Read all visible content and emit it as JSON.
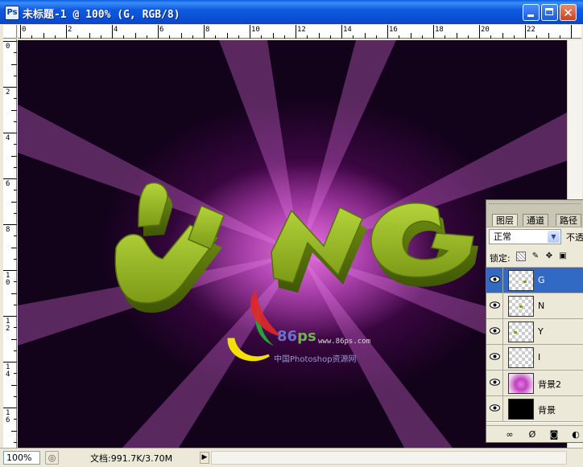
{
  "window": {
    "app_icon": "photoshop-document-icon",
    "title": "未标题-1 @ 100% (G, RGB/8)",
    "buttons": {
      "minimize": "minimize-icon",
      "maximize": "maximize-icon",
      "close_glyph": "✕"
    }
  },
  "rulers": {
    "horizontal_labels": [
      "0",
      "2",
      "4",
      "6",
      "8",
      "10",
      "12",
      "14",
      "16",
      "18",
      "20",
      "22"
    ],
    "vertical_labels": [
      "0",
      "2",
      "4",
      "6",
      "8",
      "1\n0",
      "1\n2",
      "1\n4",
      "1\n6"
    ]
  },
  "canvas": {
    "letters": [
      "Y",
      "N",
      "G"
    ],
    "text_color": "#8fb020",
    "glow_color": "#d040d0",
    "watermark": {
      "brand_a": "86",
      "brand_b": "ps",
      "url": "www.86ps.com",
      "tagline": "中国Photoshop资源网"
    }
  },
  "status": {
    "zoom": "100%",
    "doc_info": "文档:991.7K/3.70M",
    "arrow": "▶"
  },
  "layers_panel": {
    "tabs": [
      "图层",
      "通道",
      "路径"
    ],
    "active_tab": "图层",
    "blend_mode": "正常",
    "opacity_label": "不透",
    "lock_label": "锁定:",
    "layers": [
      {
        "name": "G",
        "thumb": "checker",
        "visible": true,
        "selected": true
      },
      {
        "name": "N",
        "thumb": "checker",
        "visible": true,
        "selected": false
      },
      {
        "name": "Y",
        "thumb": "checker",
        "visible": true,
        "selected": false
      },
      {
        "name": "I",
        "thumb": "checker",
        "visible": true,
        "selected": false
      },
      {
        "name": "背景2",
        "thumb": "magenta-glow",
        "visible": true,
        "selected": false
      },
      {
        "name": "背景",
        "thumb": "black",
        "visible": true,
        "selected": false
      }
    ],
    "bottom_icons": [
      "link-icon",
      "layer-style-icon",
      "layer-mask-icon",
      "adjustment-layer-icon"
    ]
  }
}
